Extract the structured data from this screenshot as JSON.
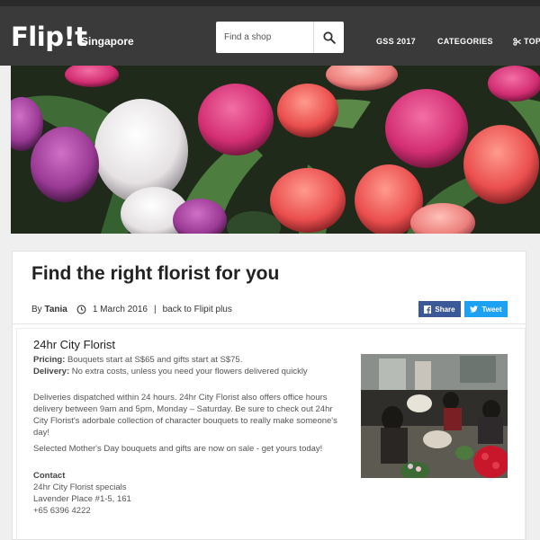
{
  "header": {
    "logo": "Flip!t",
    "logo_sub": "Singapore",
    "search_placeholder": "Find a shop",
    "nav": [
      "GSS 2017",
      "CATEGORIES",
      "TOP"
    ]
  },
  "article": {
    "title": "Find the right florist for you",
    "by_label": "By",
    "author": "Tania",
    "date": "1 March 2016",
    "separator": "|",
    "back_link": "back to Flipit plus",
    "share_facebook": "Share",
    "share_twitter": "Tweet"
  },
  "listing": {
    "name": "24hr City Florist",
    "pricing_label": "Pricing:",
    "pricing_text": "Bouquets start at S$65 and gifts start at S$75.",
    "delivery_label": "Delivery:",
    "delivery_text": "No extra costs, unless you need your flowers delivered quickly",
    "description_1": "Deliveries dispatched within 24 hours. 24hr City Florist also offers office hours delivery between 9am and 5pm, Monday – Saturday. Be sure to check out 24hr City Florist's adorbale collection of character bouquets to really make someone's day!",
    "description_2": "Selected Mother's Day bouquets and gifts are now on sale - get yours today!",
    "contact_label": "Contact",
    "contact_lines": [
      "24hr City Florist specials",
      "Lavender Place #1-5, 161",
      "+65 6396 4222"
    ]
  },
  "colors": {
    "header_bg": "#3a3a3a",
    "facebook": "#3b5998",
    "twitter": "#1da1f2"
  },
  "icons": [
    "search-icon",
    "clock-icon",
    "facebook-icon",
    "twitter-icon",
    "scissors-icon"
  ]
}
